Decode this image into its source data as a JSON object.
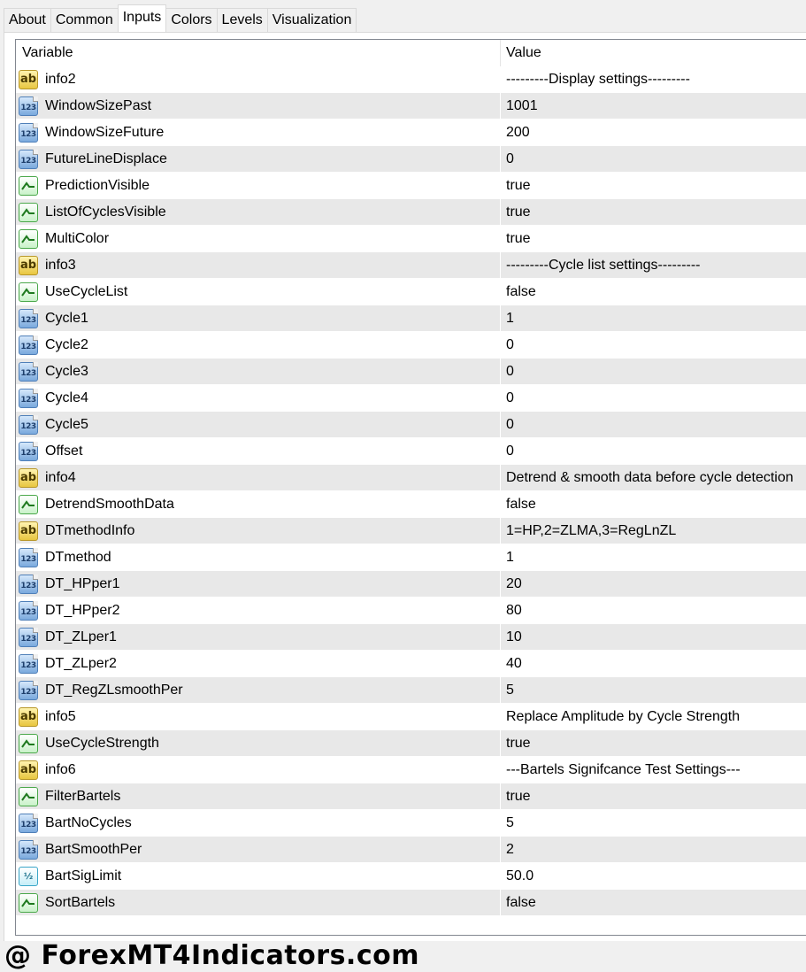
{
  "tabs": [
    {
      "label": "About",
      "active": false
    },
    {
      "label": "Common",
      "active": false
    },
    {
      "label": "Inputs",
      "active": true
    },
    {
      "label": "Colors",
      "active": false
    },
    {
      "label": "Levels",
      "active": false
    },
    {
      "label": "Visualization",
      "active": false
    }
  ],
  "columns": {
    "variable": "Variable",
    "value": "Value"
  },
  "icons": {
    "ab": "ab",
    "num": "123",
    "dbl": "½"
  },
  "rows": [
    {
      "type": "string",
      "variable": "info2",
      "value": "---------Display settings---------"
    },
    {
      "type": "int",
      "variable": "WindowSizePast",
      "value": "1001"
    },
    {
      "type": "int",
      "variable": "WindowSizeFuture",
      "value": "200"
    },
    {
      "type": "int",
      "variable": "FutureLineDisplace",
      "value": "0"
    },
    {
      "type": "bool",
      "variable": "PredictionVisible",
      "value": "true"
    },
    {
      "type": "bool",
      "variable": "ListOfCyclesVisible",
      "value": "true"
    },
    {
      "type": "bool",
      "variable": "MultiColor",
      "value": "true"
    },
    {
      "type": "string",
      "variable": "info3",
      "value": "---------Cycle list settings---------"
    },
    {
      "type": "bool",
      "variable": "UseCycleList",
      "value": "false"
    },
    {
      "type": "int",
      "variable": "Cycle1",
      "value": "1"
    },
    {
      "type": "int",
      "variable": "Cycle2",
      "value": "0"
    },
    {
      "type": "int",
      "variable": "Cycle3",
      "value": "0"
    },
    {
      "type": "int",
      "variable": "Cycle4",
      "value": "0"
    },
    {
      "type": "int",
      "variable": "Cycle5",
      "value": "0"
    },
    {
      "type": "int",
      "variable": "Offset",
      "value": "0"
    },
    {
      "type": "string",
      "variable": "info4",
      "value": "Detrend & smooth data before cycle detection"
    },
    {
      "type": "bool",
      "variable": "DetrendSmoothData",
      "value": "false"
    },
    {
      "type": "string",
      "variable": "DTmethodInfo",
      "value": "1=HP,2=ZLMA,3=RegLnZL"
    },
    {
      "type": "int",
      "variable": "DTmethod",
      "value": "1"
    },
    {
      "type": "int",
      "variable": "DT_HPper1",
      "value": "20"
    },
    {
      "type": "int",
      "variable": "DT_HPper2",
      "value": "80"
    },
    {
      "type": "int",
      "variable": "DT_ZLper1",
      "value": "10"
    },
    {
      "type": "int",
      "variable": "DT_ZLper2",
      "value": "40"
    },
    {
      "type": "int",
      "variable": "DT_RegZLsmoothPer",
      "value": "5"
    },
    {
      "type": "string",
      "variable": "info5",
      "value": "Replace Amplitude by Cycle Strength"
    },
    {
      "type": "bool",
      "variable": "UseCycleStrength",
      "value": "true"
    },
    {
      "type": "string",
      "variable": "info6",
      "value": "---Bartels Signifcance Test Settings---"
    },
    {
      "type": "bool",
      "variable": "FilterBartels",
      "value": "true"
    },
    {
      "type": "int",
      "variable": "BartNoCycles",
      "value": "5"
    },
    {
      "type": "int",
      "variable": "BartSmoothPer",
      "value": "2"
    },
    {
      "type": "double",
      "variable": "BartSigLimit",
      "value": "50.0"
    },
    {
      "type": "bool",
      "variable": "SortBartels",
      "value": "false"
    }
  ],
  "watermark": "@ ForexMT4Indicators.com"
}
